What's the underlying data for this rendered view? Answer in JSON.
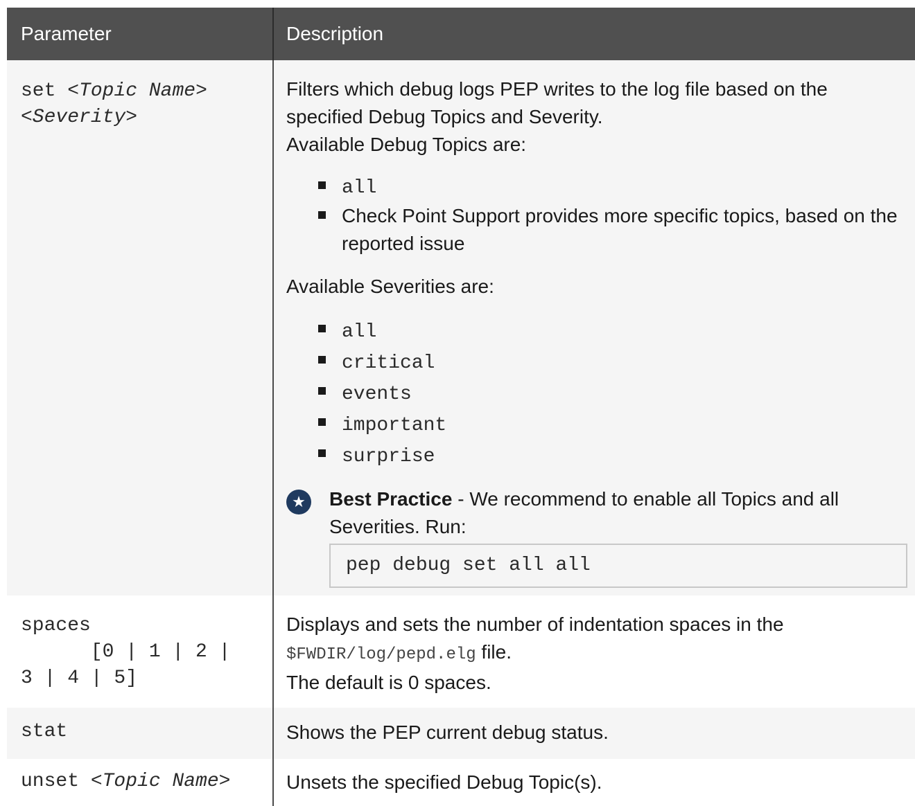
{
  "table": {
    "headers": {
      "parameter": "Parameter",
      "description": "Description"
    },
    "rows": {
      "set": {
        "param_cmd": "set",
        "param_topic": "<Topic Name>",
        "param_severity": "<Severity>",
        "desc_line1": "Filters which debug logs PEP writes to the log file based on the specified Debug Topics and Severity.",
        "desc_line2": "Available Debug Topics are:",
        "topics": [
          "all",
          "Check Point Support provides more specific topics, based on the reported issue"
        ],
        "severities_intro": "Available Severities are:",
        "severities": [
          "all",
          "critical",
          "events",
          "important",
          "surprise"
        ],
        "best_practice": {
          "icon": "star-badge-icon",
          "title": "Best Practice",
          "text": " - We recommend to enable all Topics and all Severities. Run:",
          "code": "pep debug set all all"
        }
      },
      "spaces": {
        "param_line1": "spaces",
        "param_line2": "      [0 | 1 | 2 |",
        "param_line3": "3 | 4 | 5]",
        "desc_line1": "Displays and sets the number of indentation spaces in the",
        "desc_path": "$FWDIR/log/pepd.elg",
        "desc_file": " file.",
        "desc_line3": "The default is 0 spaces."
      },
      "stat": {
        "param": "stat",
        "desc": "Shows the PEP current debug status."
      },
      "unset": {
        "param_cmd": "unset",
        "param_topic": "<Topic Name>",
        "desc": "Unsets the specified Debug Topic(s)."
      }
    }
  },
  "colors": {
    "header_bg": "#505050",
    "row_shade": "#f5f5f5",
    "icon_bg": "#1f3a5f"
  }
}
